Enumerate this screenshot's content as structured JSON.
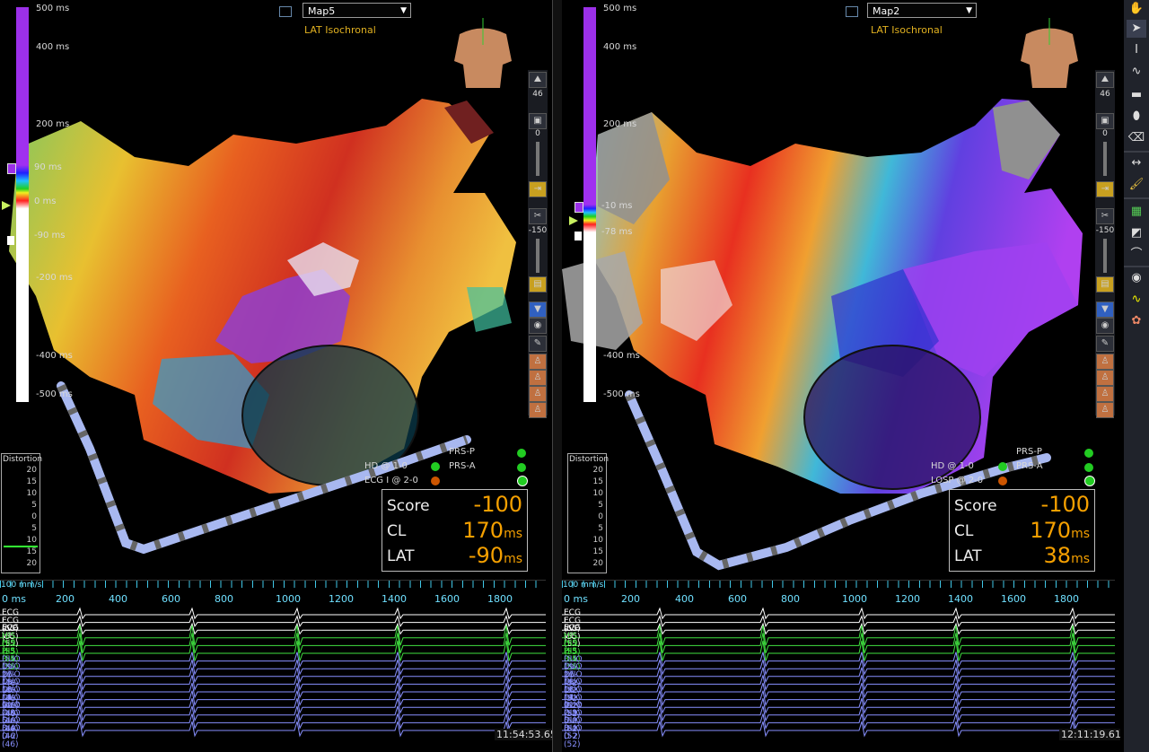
{
  "colorbar_ticks": [
    "500 ms",
    "400 ms",
    "200 ms",
    "-200 ms",
    "-400 ms",
    "-500 ms"
  ],
  "left": {
    "map_name": "Map5",
    "map_type": "LAT Isochronal",
    "marker_top": "90 ms",
    "marker_mid": "0 ms",
    "marker_bot": "-90 ms",
    "tool_count": "46",
    "slider1_value": "0",
    "slider2_value": "-150",
    "catheter_labels": [
      "HD @ 1-0",
      "ECG I @ 2-0",
      "PRS-P",
      "PRS-A"
    ],
    "stats": {
      "score_label": "Score",
      "score": "-100",
      "cl_label": "CL",
      "cl": "170",
      "lat_label": "LAT",
      "lat": "-90",
      "unit": "ms"
    },
    "distortion_title": "Distortion",
    "distortion_ticks": [
      "20",
      "15",
      "10",
      "5",
      "0",
      "5",
      "10",
      "15",
      "20"
    ],
    "ruler_label": "100 mm/s",
    "ruler_ticks": [
      "0 ms",
      "200",
      "400",
      "600",
      "800",
      "1000",
      "1200",
      "1400",
      "1600",
      "1800"
    ],
    "channels": [
      "ECG I (55)",
      "ECG aVF (55)",
      "ECG V1 (55)",
      "HIS D-2 (55)",
      "HIS 2-3 (55)",
      "HIS 3-4 (55)",
      "DUO 19-20 (46)",
      "DUO 17-18 (46)",
      "DUO 15-16 (46)",
      "DUO 13-14 (46)",
      "DUO 11-12 (46)",
      "DUO 9-10 (46)",
      "DUO 7-8 (46)",
      "DUO 5-6 (46)",
      "DUO 3-4 (46)",
      "DUO D-2 (46)"
    ],
    "timestamp": "11:54:53.65"
  },
  "right": {
    "map_name": "Map2",
    "map_type": "LAT Isochronal",
    "marker_top": "-10 ms",
    "marker_bot": "-78 ms",
    "tool_count": "46",
    "slider1_value": "0",
    "slider2_value": "-150",
    "catheter_labels": [
      "HD @ 1-0",
      "LOSP @ 2-0",
      "PRS-P",
      "PRS-A"
    ],
    "stats": {
      "score_label": "Score",
      "score": "-100",
      "cl_label": "CL",
      "cl": "170",
      "lat_label": "LAT",
      "lat": "38",
      "unit": "ms"
    },
    "distortion_title": "Distortion",
    "distortion_ticks": [
      "20",
      "15",
      "10",
      "5",
      "0",
      "5",
      "10",
      "15",
      "20"
    ],
    "ruler_label": "100 mm/s",
    "ruler_ticks": [
      "0 ms",
      "200",
      "400",
      "600",
      "800",
      "1000",
      "1200",
      "1400",
      "1600",
      "1800"
    ],
    "channels": [
      "ECG I (55)",
      "ECG aVF (55)",
      "ECG V1 (55)",
      "HIS D-2 (55)",
      "HIS 2-3 (55)",
      "HIS 3-4 (55)",
      "DUO 19-20 (52)",
      "DUO 17-18 (52)",
      "DUO 15-16 (52)",
      "DUO 13-14 (52)",
      "DUO 11-12 (52)",
      "DUO 9-10 (52)",
      "DUO 7-8 (52)",
      "DUO 5-6 (52)",
      "DUO 3-4 (52)",
      "DUO D-2 (52)"
    ],
    "timestamp": "12:11:19.61"
  },
  "channel_colors": {
    "ecg": "#ffffff",
    "his": "#40e040",
    "duo": "#8890ff"
  },
  "right_toolbar_icons": [
    "hand-icon",
    "pointer-icon",
    "cursor-text-icon",
    "curve-icon",
    "ruler-icon",
    "ellipse-icon",
    "eraser-icon",
    "caliper-icon",
    "brush-icon",
    "grid-icon",
    "shade-icon",
    "catheter-icon",
    "eye-icon",
    "wave-icon",
    "palette-icon"
  ]
}
